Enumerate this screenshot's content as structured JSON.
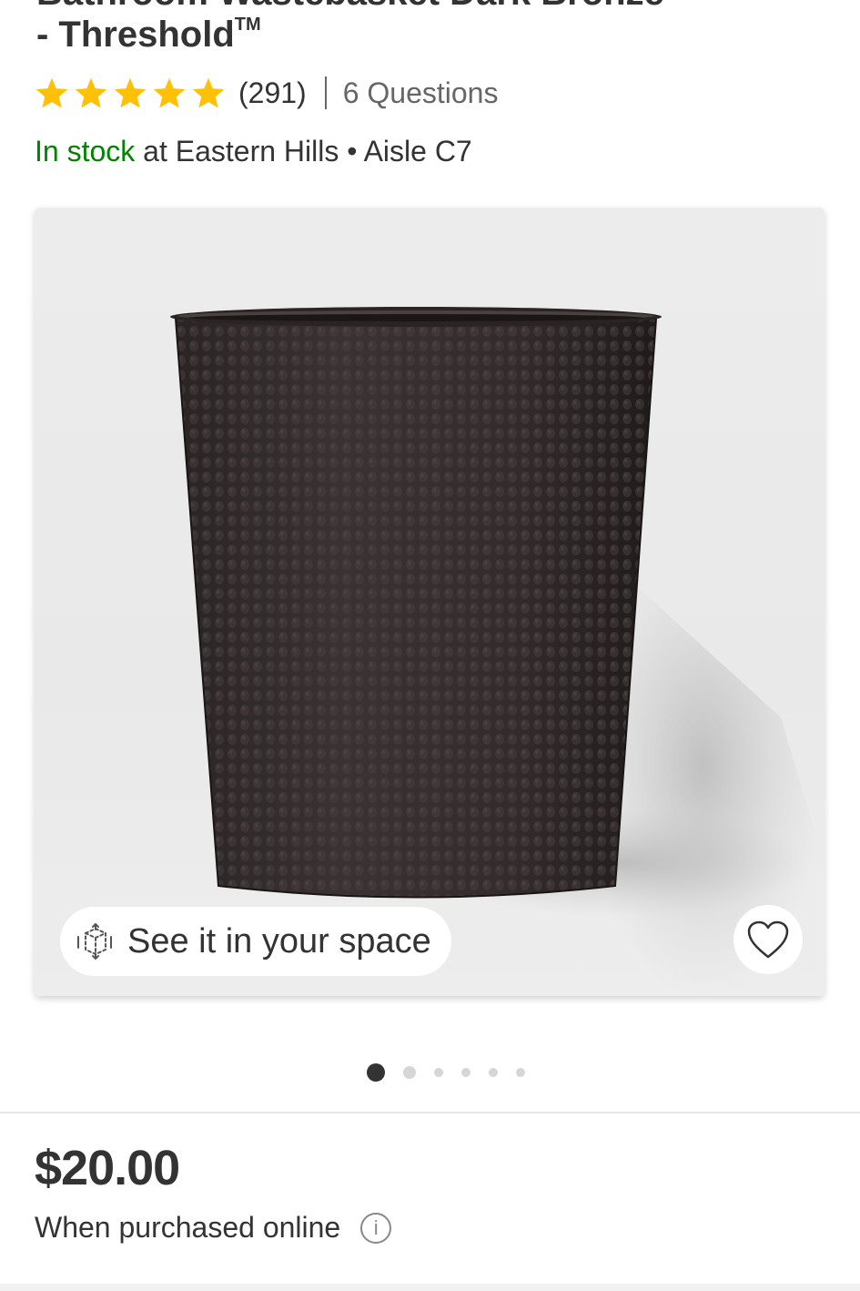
{
  "product": {
    "title_cut_line": "Bathroom Wastebasket Dark Bronze",
    "title_line": "- Threshold",
    "trademark": "TM",
    "rating_stars": 5,
    "review_count": "(291)",
    "questions": "6 Questions",
    "stock_status": "In stock",
    "stock_location": " at Eastern Hills • Aisle C7",
    "price": "$20.00",
    "price_note": "When purchased online"
  },
  "image_card": {
    "see_in_space_label": "See it in your space",
    "carousel_total": 6,
    "carousel_active": 1
  },
  "icons": {
    "star": "star-icon",
    "ar": "ar-cube-icon",
    "favorite": "heart-outline-icon",
    "info": "info-icon"
  },
  "colors": {
    "star": "#FFC107",
    "in_stock": "#008300",
    "text": "#333333",
    "muted": "#666666"
  }
}
